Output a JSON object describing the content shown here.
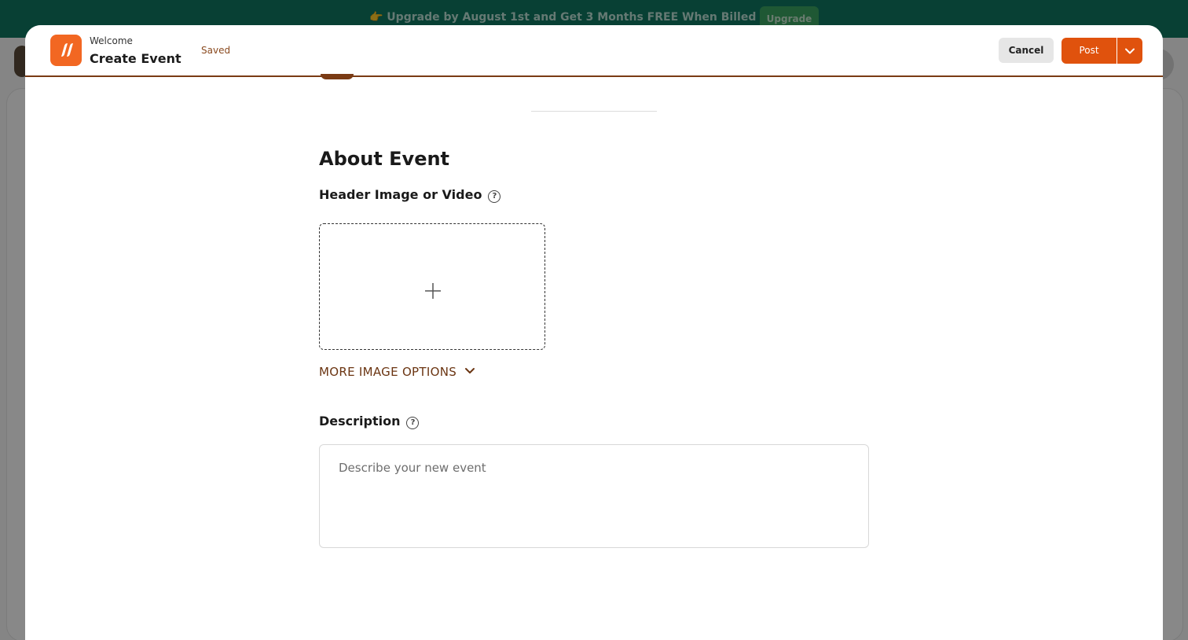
{
  "banner": {
    "text": "👉 Upgrade by August 1st and Get 3 Months FREE When Billed Annually",
    "button": "Upgrade"
  },
  "header": {
    "subtitle": "Welcome",
    "title": "Create Event",
    "status": "Saved",
    "cancel_label": "Cancel",
    "post_label": "Post"
  },
  "about": {
    "title": "About Event",
    "header_label": "Header Image or Video",
    "more_options": "MORE IMAGE OPTIONS",
    "description_label": "Description",
    "description_placeholder": "Describe your new event"
  },
  "colors": {
    "accent": "#e0520d",
    "brand_brown": "#7a3b14",
    "banner": "#0f7660"
  },
  "icons": {
    "help": "?"
  }
}
